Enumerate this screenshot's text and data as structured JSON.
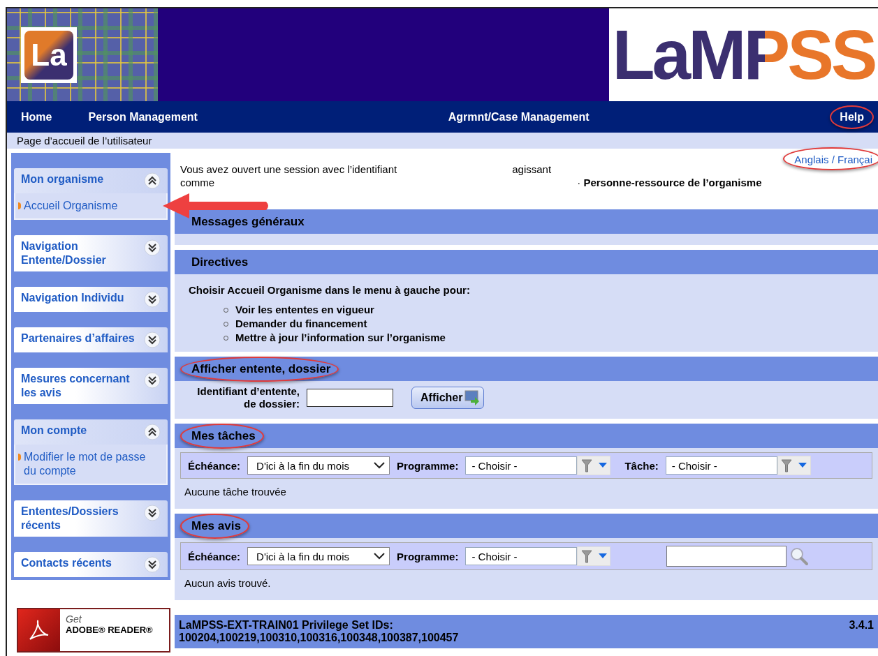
{
  "header": {
    "small_logo": "La",
    "logo": "LaMPSS"
  },
  "nav": [
    {
      "label": "Home",
      "circled": false
    },
    {
      "label": "Person Management",
      "circled": false
    },
    {
      "label": "Agrmnt/Case Management",
      "circled": false
    },
    {
      "label": "Help",
      "circled": true
    }
  ],
  "breadcrumb": "Page d’accueil de l’utilisateur",
  "sidebar": [
    {
      "title": "Mon organisme",
      "expanded": true,
      "children": [
        {
          "label": "Accueil Organisme",
          "pointed": true
        }
      ]
    },
    {
      "title": "Navigation Entente/Dossier",
      "expanded": false
    },
    {
      "title": "Navigation Individu",
      "expanded": false
    },
    {
      "title": "Partenaires d’affaires",
      "expanded": false
    },
    {
      "title": "Mesures concernant les avis",
      "expanded": false
    },
    {
      "title": "Mon compte",
      "expanded": true,
      "children": [
        {
          "label": "Modifier le mot de passe du compte",
          "pointed": false
        }
      ]
    },
    {
      "title": "Ententes/Dossiers récents",
      "expanded": false
    },
    {
      "title": "Contacts récents",
      "expanded": false
    }
  ],
  "adobe_badge": {
    "line_1": "Get",
    "line_2": "ADOBE® READER®"
  },
  "language_link": {
    "label": "Anglais / Françai",
    "circled": true
  },
  "session": {
    "line_1a": "Vous avez ouvert une session avec l’identifiant",
    "line_1b": "agissant",
    "line_2a": "comme",
    "line_2b": "· **Personne-ressource de l’organisme**"
  },
  "sections": [
    {
      "kind": "empty",
      "title": "Messages généraux",
      "circled": false
    },
    {
      "kind": "directives",
      "title": "Directives",
      "circled": false,
      "intro": "Choisir Accueil Organisme dans le menu à gauche pour:",
      "bullets": [
        "Voir les ententes en vigueur",
        "Demander du financement",
        "Mettre à jour l’information sur l’organisme"
      ]
    },
    {
      "kind": "lookup",
      "title": "Afficher entente, dossier",
      "circled": true,
      "label": "Identifiant d’entente, de dossier:",
      "button": "Afficher"
    },
    {
      "kind": "list",
      "title": "Mes tâches",
      "circled": true,
      "filters": [
        {
          "kind": "select",
          "label": "Échéance:",
          "value": "D'ici à la fin du mois"
        },
        {
          "kind": "combo",
          "label": "Programme:",
          "value": "- Choisir -"
        },
        {
          "kind": "combo",
          "label": "Tâche:",
          "value": "- Choisir -"
        }
      ],
      "empty_text": "Aucune tâche trouvée"
    },
    {
      "kind": "list",
      "title": "Mes avis",
      "circled": true,
      "filters": [
        {
          "kind": "select",
          "label": "Échéance:",
          "value": "D'ici à la fin du mois"
        },
        {
          "kind": "combo",
          "label": "Programme:",
          "value": "- Choisir -"
        },
        {
          "kind": "search"
        }
      ],
      "empty_text": "Aucun avis trouvé."
    }
  ],
  "footer": {
    "text": "LaMPSS-EXT-TRAIN01 Privilege Set IDs: 100204,100219,100310,100316,100348,100387,100457",
    "version": "3.4.1"
  }
}
